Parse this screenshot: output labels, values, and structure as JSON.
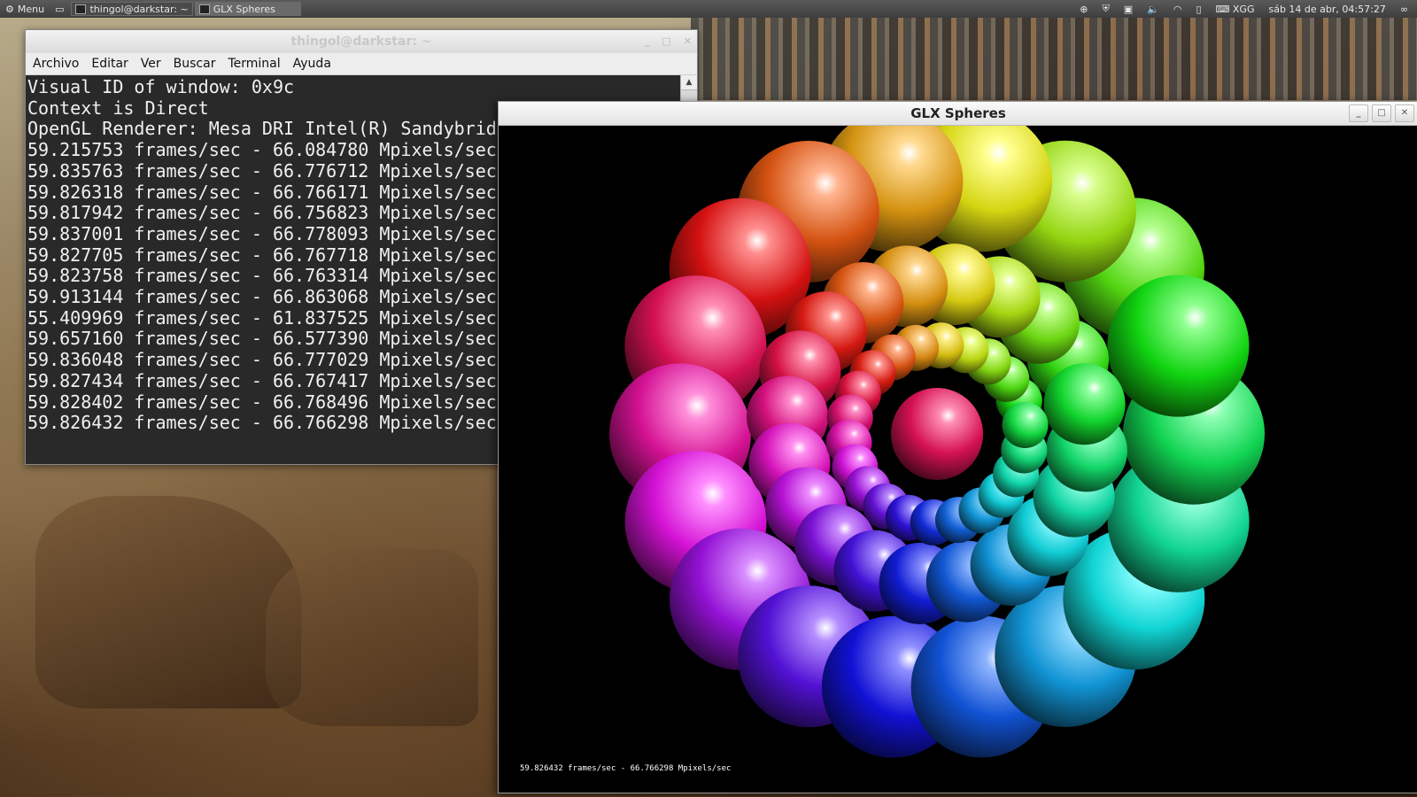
{
  "panel": {
    "menu_label": "Menu",
    "tasks": [
      {
        "label": "thingol@darkstar: ~"
      },
      {
        "label": "GLX Spheres"
      }
    ],
    "tray": {
      "keyboard": "XGG",
      "clock": "sáb 14 de abr, 04:57:27"
    }
  },
  "terminal": {
    "title": "thingol@darkstar: ~",
    "menu": [
      "Archivo",
      "Editar",
      "Ver",
      "Buscar",
      "Terminal",
      "Ayuda"
    ],
    "lines": [
      "Visual ID of window: 0x9c",
      "Context is Direct",
      "OpenGL Renderer: Mesa DRI Intel(R) Sandybridge",
      "59.215753 frames/sec - 66.084780 Mpixels/sec",
      "59.835763 frames/sec - 66.776712 Mpixels/sec",
      "59.826318 frames/sec - 66.766171 Mpixels/sec",
      "59.817942 frames/sec - 66.756823 Mpixels/sec",
      "59.837001 frames/sec - 66.778093 Mpixels/sec",
      "59.827705 frames/sec - 66.767718 Mpixels/sec",
      "59.823758 frames/sec - 66.763314 Mpixels/sec",
      "59.913144 frames/sec - 66.863068 Mpixels/sec",
      "55.409969 frames/sec - 61.837525 Mpixels/sec",
      "59.657160 frames/sec - 66.577390 Mpixels/sec",
      "59.836048 frames/sec - 66.777029 Mpixels/sec",
      "59.827434 frames/sec - 66.767417 Mpixels/sec",
      "59.828402 frames/sec - 66.768496 Mpixels/sec",
      "59.826432 frames/sec - 66.766298 Mpixels/sec"
    ]
  },
  "glx": {
    "title": "GLX Spheres",
    "status": "59.826432 frames/sec - 66.766298 Mpixels/sec"
  },
  "colors": {
    "panel_bg": "#464646",
    "terminal_bg": "#2e2e2e",
    "glx_bg": "#000000"
  }
}
